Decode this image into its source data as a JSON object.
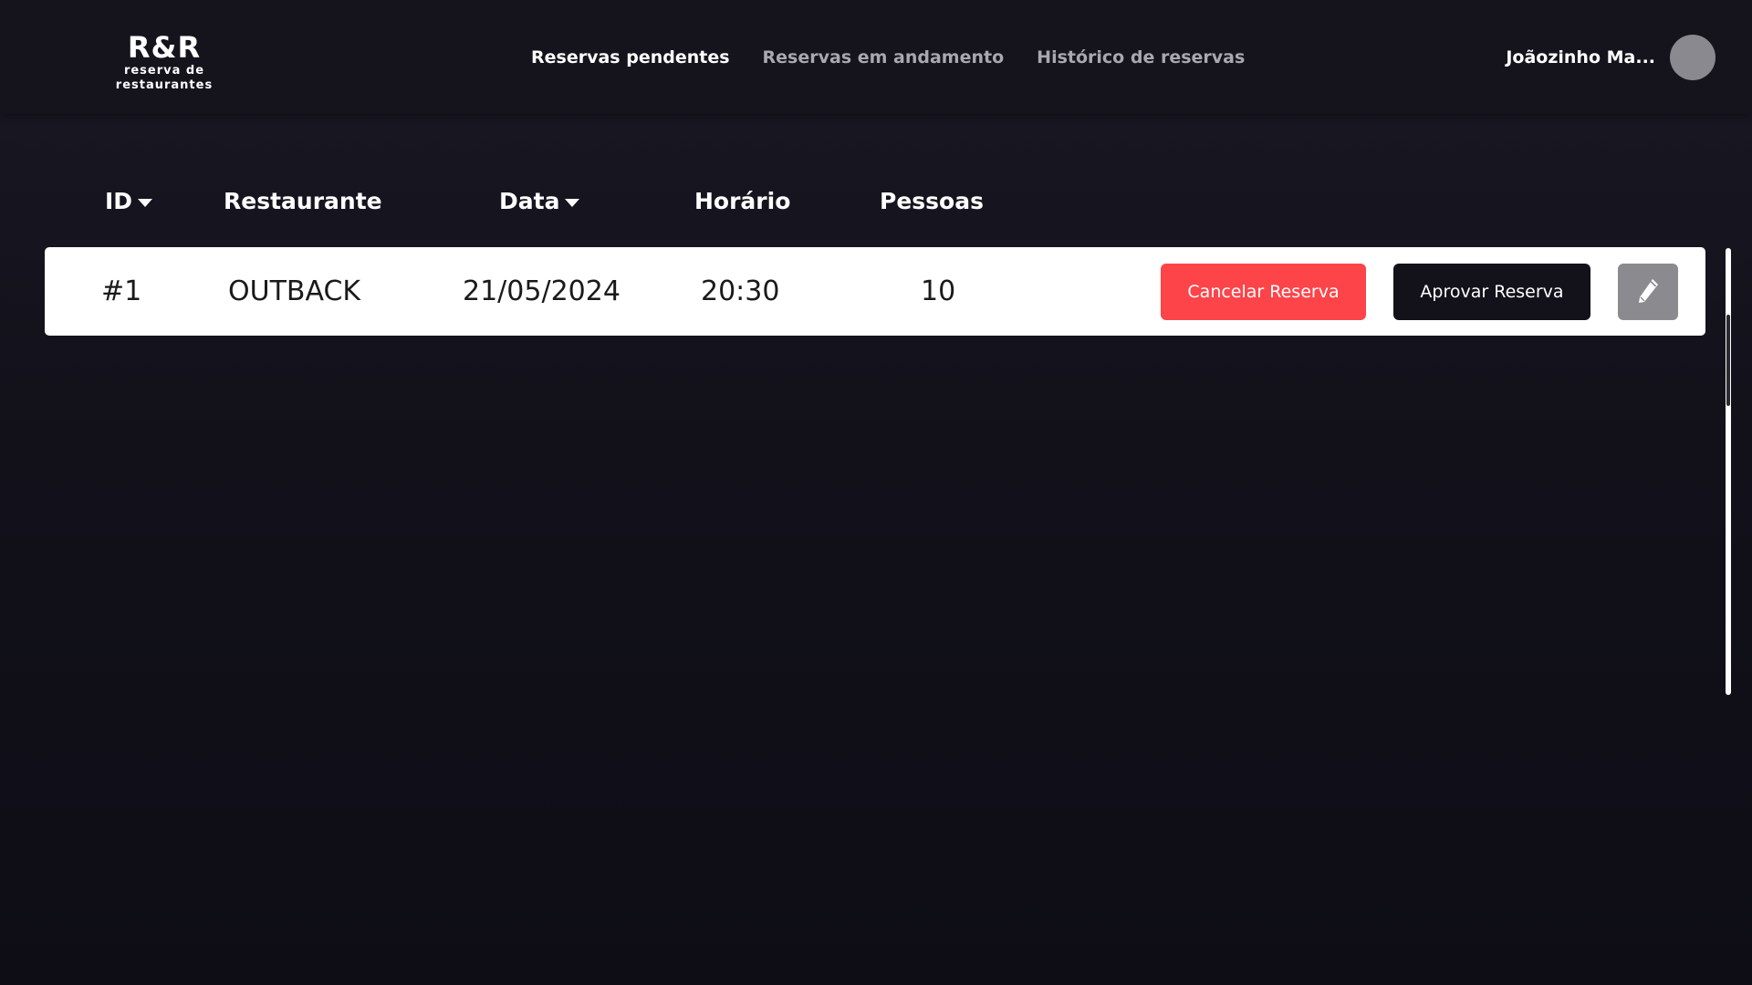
{
  "logo": {
    "title": "R&R",
    "subtitle": "reserva de restaurantes"
  },
  "nav": {
    "items": [
      {
        "label": "Reservas pendentes",
        "active": true
      },
      {
        "label": "Reservas em andamento",
        "active": false
      },
      {
        "label": "Histórico de reservas",
        "active": false
      }
    ]
  },
  "user": {
    "name": "Joãozinho Ma..."
  },
  "table": {
    "columns": [
      "ID",
      "Restaurante",
      "Data",
      "Horário",
      "Pessoas"
    ],
    "sortable_icons": [
      "caret-down-icon",
      "caret-down-icon"
    ],
    "rows": [
      {
        "id": "#1",
        "restaurant": "OUTBACK",
        "date": "21/05/2024",
        "time": "20:30",
        "people": "10",
        "cancel_label": "Cancelar Reserva",
        "approve_label": "Aprovar Reserva",
        "edit_icon": "pencil-icon"
      }
    ]
  },
  "colors": {
    "background": "#100f19",
    "header": "#15141d",
    "cancel": "#fd4449",
    "approve": "#13121b",
    "edit": "#8b8b8f",
    "avatar": "#8a898f"
  }
}
